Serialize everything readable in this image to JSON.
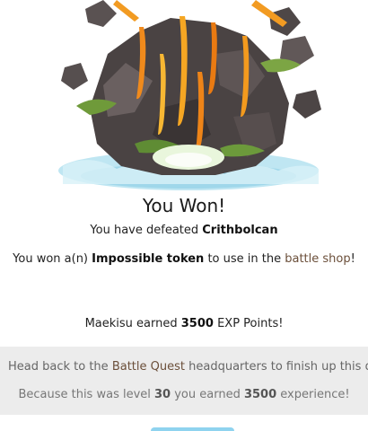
{
  "result": {
    "title": "You Won!",
    "defeated_prefix": "You have defeated ",
    "monster_name": "Crithbolcan"
  },
  "reward": {
    "prefix": "You won a(n) ",
    "item": "Impossible token",
    "middle": " to use in the ",
    "shop_link": "battle shop",
    "suffix": "!"
  },
  "experience": {
    "player": "Maekisu",
    "earned_text": " earned ",
    "points": "3500",
    "suffix": " EXP Points!"
  },
  "info": {
    "row1_prefix": "Head back to the ",
    "hq_link": "Battle Quest",
    "row1_suffix": " headquarters to finish up this quest",
    "row2_prefix": "Because this was level ",
    "level": "30",
    "row2_middle": " you earned ",
    "experience": "3500",
    "row2_suffix": " experience!"
  },
  "colors": {
    "link": "#6b4f3a",
    "panel": "#ececec",
    "button": "#8fd3ef"
  }
}
